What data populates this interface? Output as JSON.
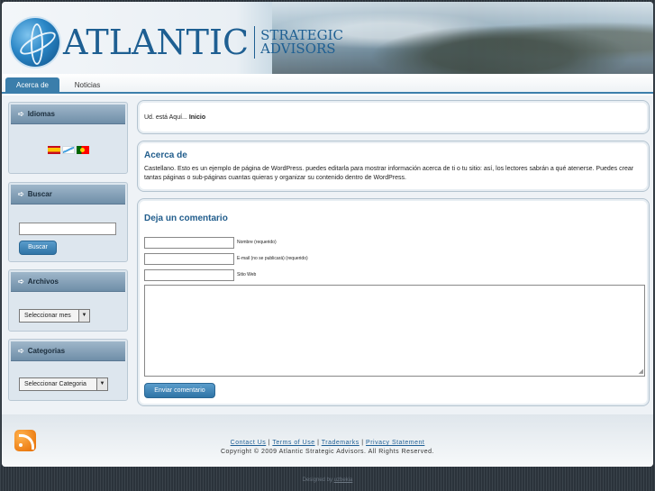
{
  "header": {
    "logo_main": "ATLANTIC",
    "logo_sub_line1": "STRATEGIC",
    "logo_sub_line2": "ADVISORS"
  },
  "nav": {
    "tabs": [
      {
        "label": "Acerca de",
        "active": true
      },
      {
        "label": "Noticias",
        "active": false
      }
    ]
  },
  "sidebar": {
    "idiomas": {
      "title": "Idiomas",
      "flags": [
        "es-flag",
        "gl-flag",
        "pt-flag"
      ]
    },
    "buscar": {
      "title": "Buscar",
      "input_value": "",
      "button_label": "Buscar"
    },
    "archivos": {
      "title": "Archivos",
      "select_value": "Seleccionar mes"
    },
    "categorias": {
      "title": "Categorias",
      "select_value": "Seleccionar Categoria"
    }
  },
  "main": {
    "breadcrumb_prefix": "Ud. está Aquí... ",
    "breadcrumb_current": "Inicio",
    "page_title": "Acerca de",
    "page_text": "Castellano. Esto es un ejemplo de página de WordPress. puedes editarla para mostrar información acerca de ti o tu sitio: así, los lectores sabrán a qué atenerse. Puedes crear tantas páginas o sub-páginas cuantas quieras y organizar su contenido dentro de WordPress.",
    "comment": {
      "title": "Deja un comentario",
      "name_label": "Nombre (requerido)",
      "email_label": "E-mail (no se publicará) (requerido)",
      "web_label": "Sitio Web",
      "submit_label": "Enviar comentario"
    }
  },
  "footer": {
    "links": [
      "Contact Us",
      "Terms of Use",
      "Trademarks",
      "Privacy Statement"
    ],
    "separator": "|",
    "copyright": "Copyright © 2009 Atlantic Strategic Advisors. All Rights Reserved.",
    "designed_prefix": "Designed by ",
    "designed_link": "uzbekia"
  },
  "colors": {
    "accent": "#3b7eab",
    "title": "#215d8c",
    "rss": "#e56a00"
  }
}
